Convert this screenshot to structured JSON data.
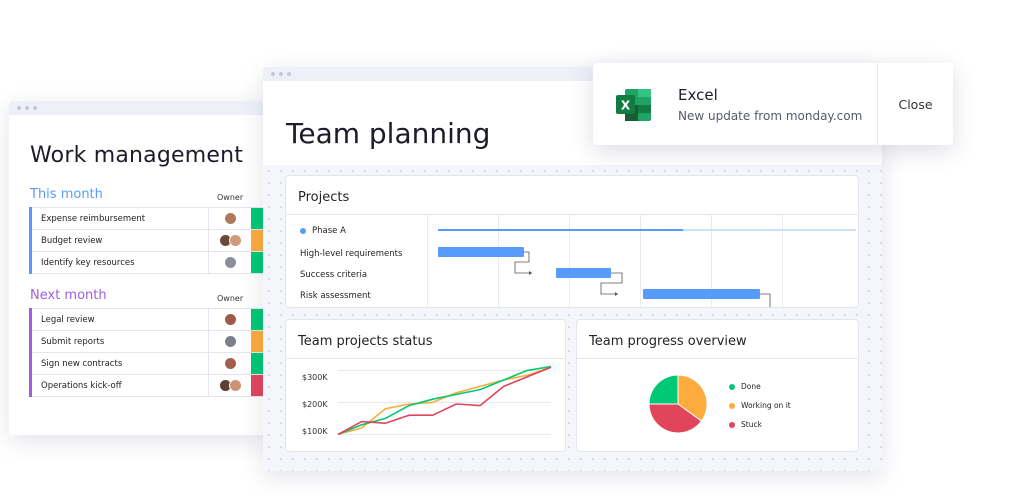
{
  "work": {
    "title": "Work management",
    "owner_label": "Owner",
    "groups": [
      {
        "title": "This month",
        "color": "#579bfc",
        "items": [
          {
            "label": "Expense reimbursement",
            "status_color": "#00c875"
          },
          {
            "label": "Budget review",
            "status_color": "#fdab3d"
          },
          {
            "label": "Identify key resources",
            "status_color": "#00c875"
          }
        ]
      },
      {
        "title": "Next month",
        "color": "#a25ddc",
        "items": [
          {
            "label": "Legal review",
            "status_color": "#00c875"
          },
          {
            "label": "Submit reports",
            "status_color": "#fdab3d"
          },
          {
            "label": "Sign new contracts",
            "status_color": "#00c875"
          },
          {
            "label": "Operations kick-off",
            "status_color": "#e2445c"
          }
        ]
      }
    ]
  },
  "team": {
    "title": "Team planning",
    "projects": {
      "title": "Projects",
      "phase": "Phase A",
      "tasks": [
        "High-level requirements",
        "Success criteria",
        "Risk assessment"
      ]
    },
    "status_card": {
      "title": "Team projects status"
    },
    "progress_card": {
      "title": "Team progress overview"
    }
  },
  "toast": {
    "app": "Excel",
    "message": "New update from monday.com",
    "close": "Close",
    "icon": "excel-icon"
  },
  "colors": {
    "done": "#00c875",
    "working": "#fdab3d",
    "stuck": "#e2445c",
    "blue": "#579bfc",
    "purple": "#a25ddc"
  },
  "chart_data": [
    {
      "type": "line",
      "title": "Team projects status",
      "yticks": [
        "$100K",
        "$200K",
        "$300K"
      ],
      "ylim": [
        70,
        320
      ],
      "x": [
        0,
        1,
        2,
        3,
        4,
        5,
        6,
        7,
        8,
        9
      ],
      "series": [
        {
          "color": "#fdab3d",
          "values": [
            100,
            120,
            180,
            195,
            200,
            230,
            250,
            270,
            285,
            310
          ]
        },
        {
          "color": "#00c875",
          "values": [
            100,
            130,
            150,
            190,
            210,
            225,
            240,
            270,
            300,
            312
          ]
        },
        {
          "color": "#e2445c",
          "values": [
            100,
            140,
            135,
            160,
            160,
            195,
            190,
            250,
            280,
            310
          ]
        }
      ]
    },
    {
      "type": "pie",
      "title": "Team progress overview",
      "categories": [
        "Done",
        "Working on it",
        "Stuck"
      ],
      "values": [
        25,
        35,
        40
      ],
      "colors": [
        "#00c875",
        "#fdab3d",
        "#e2445c"
      ]
    }
  ]
}
